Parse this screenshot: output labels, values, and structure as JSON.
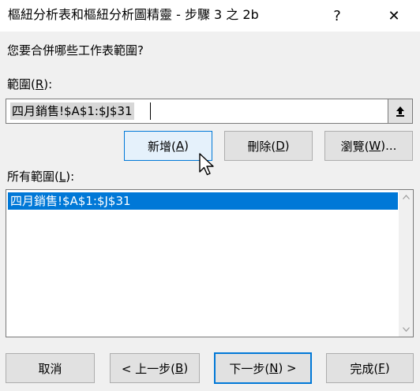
{
  "window": {
    "title": "樞紐分析表和樞紐分析圖精靈 - 步驟 3 之 2b",
    "help_label": "?",
    "close_label": "✕"
  },
  "prompt": "您要合併哪些工作表範圍?",
  "range": {
    "label_pre": "範圍(",
    "label_key": "R",
    "label_post": "):",
    "value": "四月銷售!$A$1:$J$31"
  },
  "range_buttons": {
    "add": {
      "pre": "新增(",
      "key": "A",
      "post": ")"
    },
    "delete": {
      "pre": "刪除(",
      "key": "D",
      "post": ")"
    },
    "browse": {
      "pre": "瀏覽(",
      "key": "W",
      "post": ")..."
    }
  },
  "all_ranges": {
    "label_pre": "所有範圍(",
    "label_key": "L",
    "label_post": "):",
    "items": [
      "四月銷售!$A$1:$J$31"
    ]
  },
  "footer": {
    "cancel": {
      "pre": "取消",
      "key": "",
      "post": ""
    },
    "back": {
      "pre": "< 上一步(",
      "key": "B",
      "post": ")"
    },
    "next": {
      "pre": "下一步(",
      "key": "N",
      "post": ") >"
    },
    "finish": {
      "pre": "完成(",
      "key": "F",
      "post": ")"
    }
  },
  "icons": {
    "collapse": "collapse-dialog-icon",
    "cursor": "mouse-pointer-icon",
    "scroll_up": "scroll-up-arrow-icon",
    "scroll_down": "scroll-down-arrow-icon"
  },
  "colors": {
    "selection": "#0078d7",
    "button_face": "#e1e1e1",
    "hover_face": "#e5f1fb"
  }
}
